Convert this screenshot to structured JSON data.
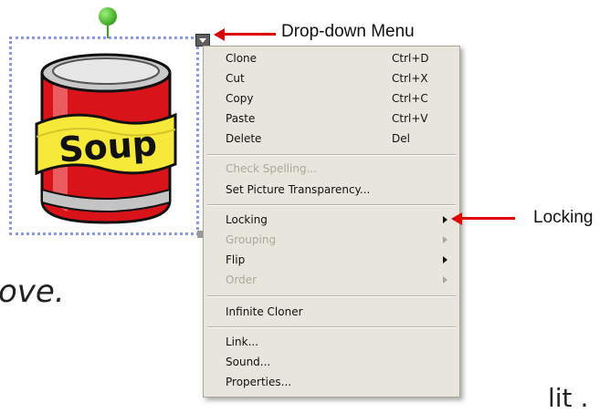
{
  "annotations": {
    "dropdown_label": "Drop-down Menu",
    "locking_label": "Locking"
  },
  "background_text": {
    "italic_fragment": "ove.",
    "bottom_fragment": "lit ."
  },
  "image": {
    "label": "Soup",
    "colors": {
      "can_red": "#d8141a",
      "label_yellow": "#f6e93a",
      "handle_green": "#3aa61e"
    }
  },
  "menu": {
    "items": [
      {
        "label": "Clone",
        "shortcut": "Ctrl+D"
      },
      {
        "label": "Cut",
        "shortcut": "Ctrl+X"
      },
      {
        "label": "Copy",
        "shortcut": "Ctrl+C"
      },
      {
        "label": "Paste",
        "shortcut": "Ctrl+V"
      },
      {
        "label": "Delete",
        "shortcut": "Del"
      },
      {
        "label": "Check Spelling...",
        "disabled": true
      },
      {
        "label": "Set Picture Transparency..."
      },
      {
        "label": "Locking",
        "submenu": true
      },
      {
        "label": "Grouping",
        "submenu": true,
        "disabled": true
      },
      {
        "label": "Flip",
        "submenu": true
      },
      {
        "label": "Order",
        "submenu": true,
        "disabled": true
      },
      {
        "label": "Infinite Cloner"
      },
      {
        "label": "Link..."
      },
      {
        "label": "Sound..."
      },
      {
        "label": "Properties..."
      }
    ]
  },
  "colors": {
    "menu_bg": "#e8e6dc",
    "arrow_red": "#e00000",
    "selection": "#8a98e6"
  }
}
